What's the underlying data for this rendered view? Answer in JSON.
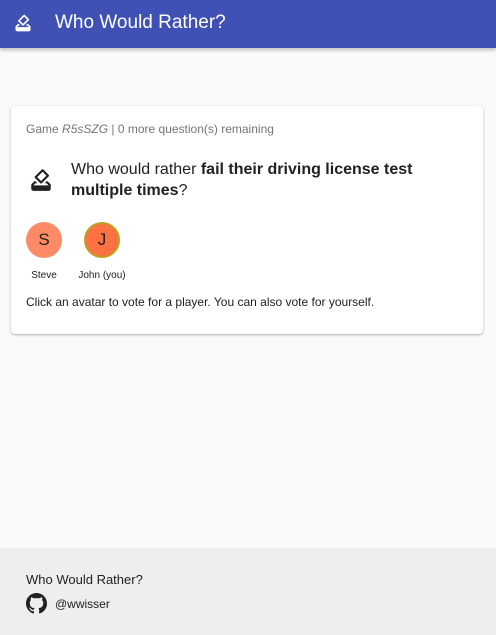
{
  "header": {
    "title": "Who Would Rather?",
    "logo_icon": "ballot-icon",
    "color": "#3f51b5"
  },
  "card": {
    "game_prefix": "Game",
    "game_code": "R5sSZG",
    "remaining": "| 0 more question(s) remaining",
    "question_icon": "ballot-icon",
    "question_prefix": "Who would rather",
    "question_bold": "fail their driving license test multiple times",
    "question_suffix": "?",
    "players": [
      {
        "initial": "S",
        "name": "Steve",
        "color": "#ff8a65"
      },
      {
        "initial": "J",
        "name": "John (you)",
        "color": "#ff7043",
        "border": "#c0a020"
      }
    ],
    "hint": "Click an avatar to vote for a player. You can also vote for yourself."
  },
  "footer": {
    "title": "Who Would Rather?",
    "icon": "github-icon",
    "handle": "@wwisser"
  }
}
